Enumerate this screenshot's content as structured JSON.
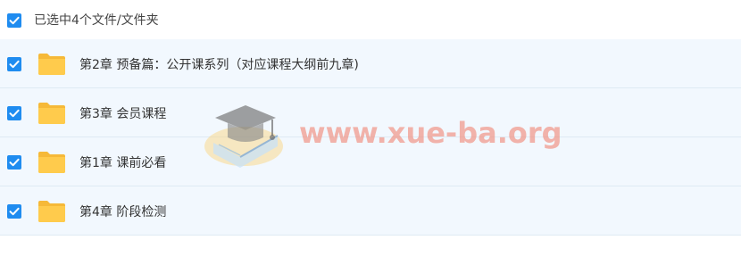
{
  "header": {
    "selection_text": "已选中4个文件/文件夹",
    "checked": true
  },
  "files": [
    {
      "name": "第2章 预备篇：公开课系列（对应课程大纲前九章)",
      "type": "folder",
      "checked": true
    },
    {
      "name": "第3章 会员课程",
      "type": "folder",
      "checked": true
    },
    {
      "name": "第1章 课前必看",
      "type": "folder",
      "checked": true
    },
    {
      "name": "第4章 阶段检测",
      "type": "folder",
      "checked": true
    }
  ],
  "watermark": {
    "text": "www.xue-ba.org",
    "icon": "graduation-cap-book-logo"
  },
  "colors": {
    "accent": "#1f8cf0",
    "folder": "#ffc94a",
    "row_bg": "#f2f8fe"
  }
}
